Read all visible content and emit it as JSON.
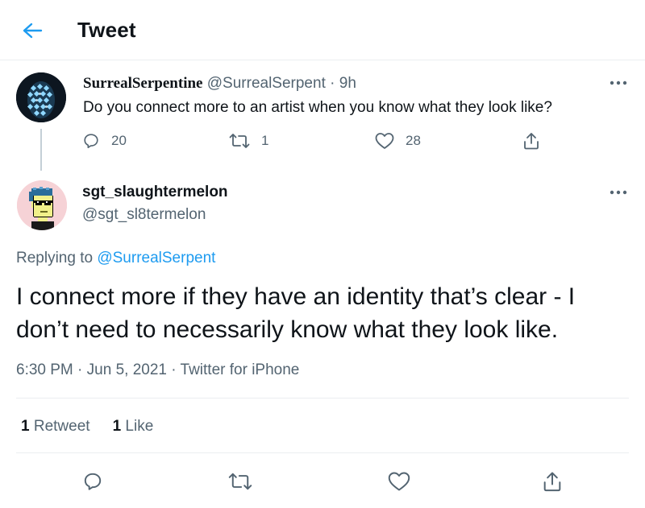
{
  "header": {
    "title": "Tweet",
    "back_icon": "arrow-left-icon"
  },
  "original_tweet": {
    "display_name": "SurrealSerpentine",
    "handle": "@SurrealSerpent",
    "separator": "·",
    "time_ago": "9h",
    "text": "Do you connect more to an artist when you know what they look like?",
    "replies": "20",
    "retweets": "1",
    "likes": "28"
  },
  "reply_tweet": {
    "display_name": "sgt_slaughtermelon",
    "handle": "@sgt_sl8termelon",
    "replying_to_label": "Replying to",
    "replying_to_handle": "@SurrealSerpent",
    "body_line1": "I connect more if they have an identity that’s clear - I",
    "body_line2": "don’t need to necessarily know what they look like.",
    "time": "6:30 PM",
    "date": "Jun 5, 2021",
    "source": "Twitter for iPhone",
    "separator": "·"
  },
  "stats": {
    "retweets_count": "1",
    "retweets_label": "Retweet",
    "likes_count": "1",
    "likes_label": "Like"
  },
  "colors": {
    "accent": "#1d9bf0",
    "text_primary": "#0f1419",
    "text_secondary": "#536471",
    "divider": "#ebeef0",
    "thread_line": "#c4cfd6"
  }
}
